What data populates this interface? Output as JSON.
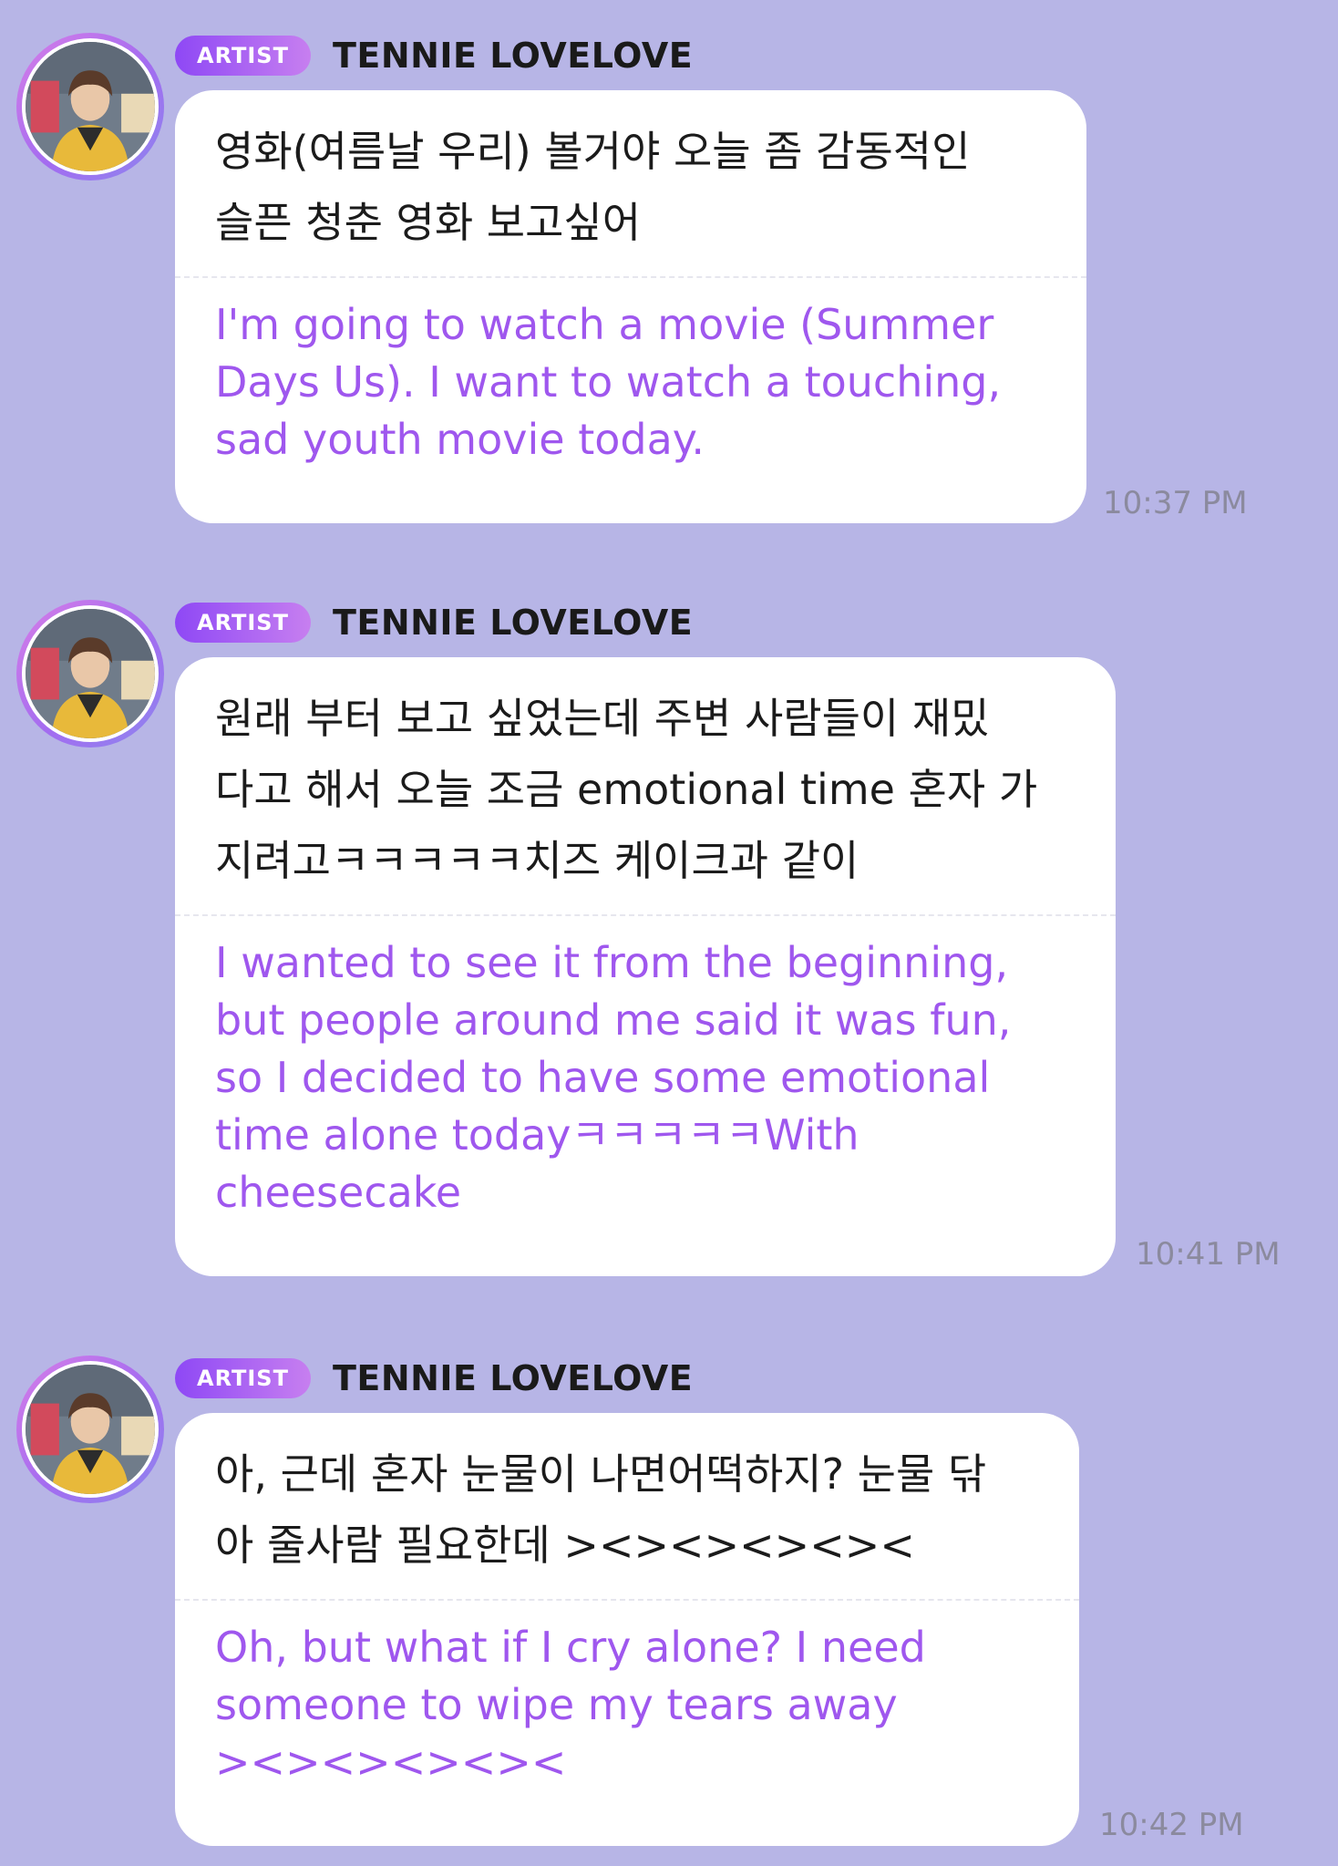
{
  "messages": [
    {
      "badge": "ARTIST",
      "name": "TENNIE LOVELOVE",
      "korean_lines": [
        "영화(여름날 우리) 볼거야 오늘 좀 감동적인",
        "슬픈 청춘 영화 보고싶어"
      ],
      "english_lines": [
        "I'm going to watch a movie (Summer",
        "Days Us). I want to watch a touching,",
        "sad youth movie today."
      ],
      "time": "10:37 PM"
    },
    {
      "badge": "ARTIST",
      "name": "TENNIE LOVELOVE",
      "korean_lines": [
        "원래 부터 보고 싶었는데 주변 사람들이 재밌",
        "다고 해서 오늘 조금 emotional time 혼자 가",
        "지려고ㅋㅋㅋㅋㅋ치즈 케이크과 같이"
      ],
      "english_lines": [
        "I wanted to see it from the beginning,",
        "but people around me said it was fun,",
        "so I decided to have some emotional",
        "time alone todayㅋㅋㅋㅋㅋWith",
        "cheesecake"
      ],
      "time": "10:41 PM"
    },
    {
      "badge": "ARTIST",
      "name": "TENNIE LOVELOVE",
      "korean_lines": [
        "아, 근데 혼자 눈물이 나면어떡하지? 눈물 닦",
        "아 줄사람 필요한데 ><><><><><"
      ],
      "english_lines": [
        "Oh, but what if I cry alone? I need",
        "someone to wipe my tears away",
        "><><><><><"
      ],
      "time": "10:42 PM"
    }
  ],
  "colors": {
    "background": "#b7b5e6",
    "bubble": "#ffffff",
    "translation_text": "#9f57ee",
    "badge_gradient_start": "#8e48f5",
    "badge_gradient_end": "#c77ff0",
    "timestamp": "#8b8a9e"
  },
  "icons": {
    "avatar": "artist-profile-photo"
  }
}
